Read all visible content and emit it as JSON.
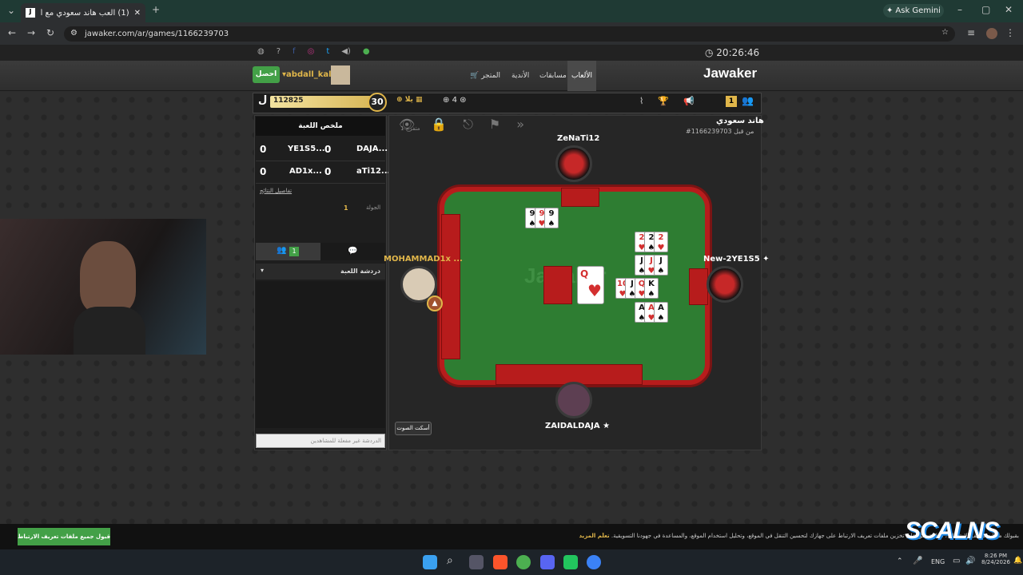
{
  "browser": {
    "tab_title": "(1) العب هاند سعودي مع أصدقا...",
    "url": "jawaker.com/ar/games/1166239703",
    "ask_gemini": "Ask Gemini"
  },
  "site": {
    "clock": "20:26:46",
    "logo": "Jawaker",
    "nav": [
      "الألعاب",
      "مسابقات",
      "الأندية",
      "المتجر"
    ],
    "username": "abdall_kal",
    "get_button": "احصل"
  },
  "gamebar": {
    "coins": "112825",
    "level": "30",
    "gift_label": "يلا",
    "plus_count": "4",
    "badge": "1"
  },
  "summary": {
    "title": "ملخص اللعبة",
    "rows": [
      {
        "left_score": "0",
        "left_name": "YE1S5...",
        "right_score": "0",
        "right_name": "DAJA..."
      },
      {
        "left_score": "0",
        "left_name": "AD1x...",
        "right_score": "0",
        "right_name": "aTi12..."
      }
    ],
    "details_link": "تفاصيل النتائج",
    "round_label": "الجولة",
    "round_value": "1"
  },
  "chat": {
    "badge": "1",
    "dropdown": "دردشة اللعبة",
    "placeholder": "الدردشة غير مفعلة للمشاهدين"
  },
  "game": {
    "title": "هاند سعودي",
    "subtitle": "#1166239703 من قبل",
    "spectators": "1 متفرج",
    "mute_button": "أسكت الصوت",
    "players": {
      "top": "ZeNaTi12",
      "left": "MOHAMMAD1x ...",
      "right": "New-2YE1S5 ✦",
      "bottom": "ZAIDALDAJA ★"
    },
    "table_logo": "Jawaker",
    "center_card": {
      "rank": "Q",
      "suit": "♥"
    },
    "top_meld": [
      "9",
      "9",
      "9"
    ],
    "right_melds": [
      [
        "2",
        "2",
        "2"
      ],
      [
        "J",
        "J",
        "J"
      ],
      [
        "10",
        "J",
        "Q",
        "K"
      ],
      [
        "A",
        "A",
        "A"
      ]
    ]
  },
  "cookie": {
    "text": "بقبولك ملفات تعريف الارتباط\" ، فإنك توافق على تخزين ملفات تعريف الارتباط على جهازك لتحسين التنقل في الموقع، وتحليل استخدام الموقع، والمساعدة في جهودنا التسويقية.",
    "learn_more": "تعلّم المزيد",
    "accept": "قبول جميع ملفات تعريف الارتباط"
  },
  "taskbar": {
    "lang": "ENG",
    "time": "8:26 PM",
    "date": "8/24/2026"
  },
  "watermark": "SCALNS",
  "colors": {
    "table_green": "#2e7d32",
    "rail_red": "#b71c1c",
    "accent_gold": "#e0b64a",
    "chrome_green": "#1f3a34"
  }
}
